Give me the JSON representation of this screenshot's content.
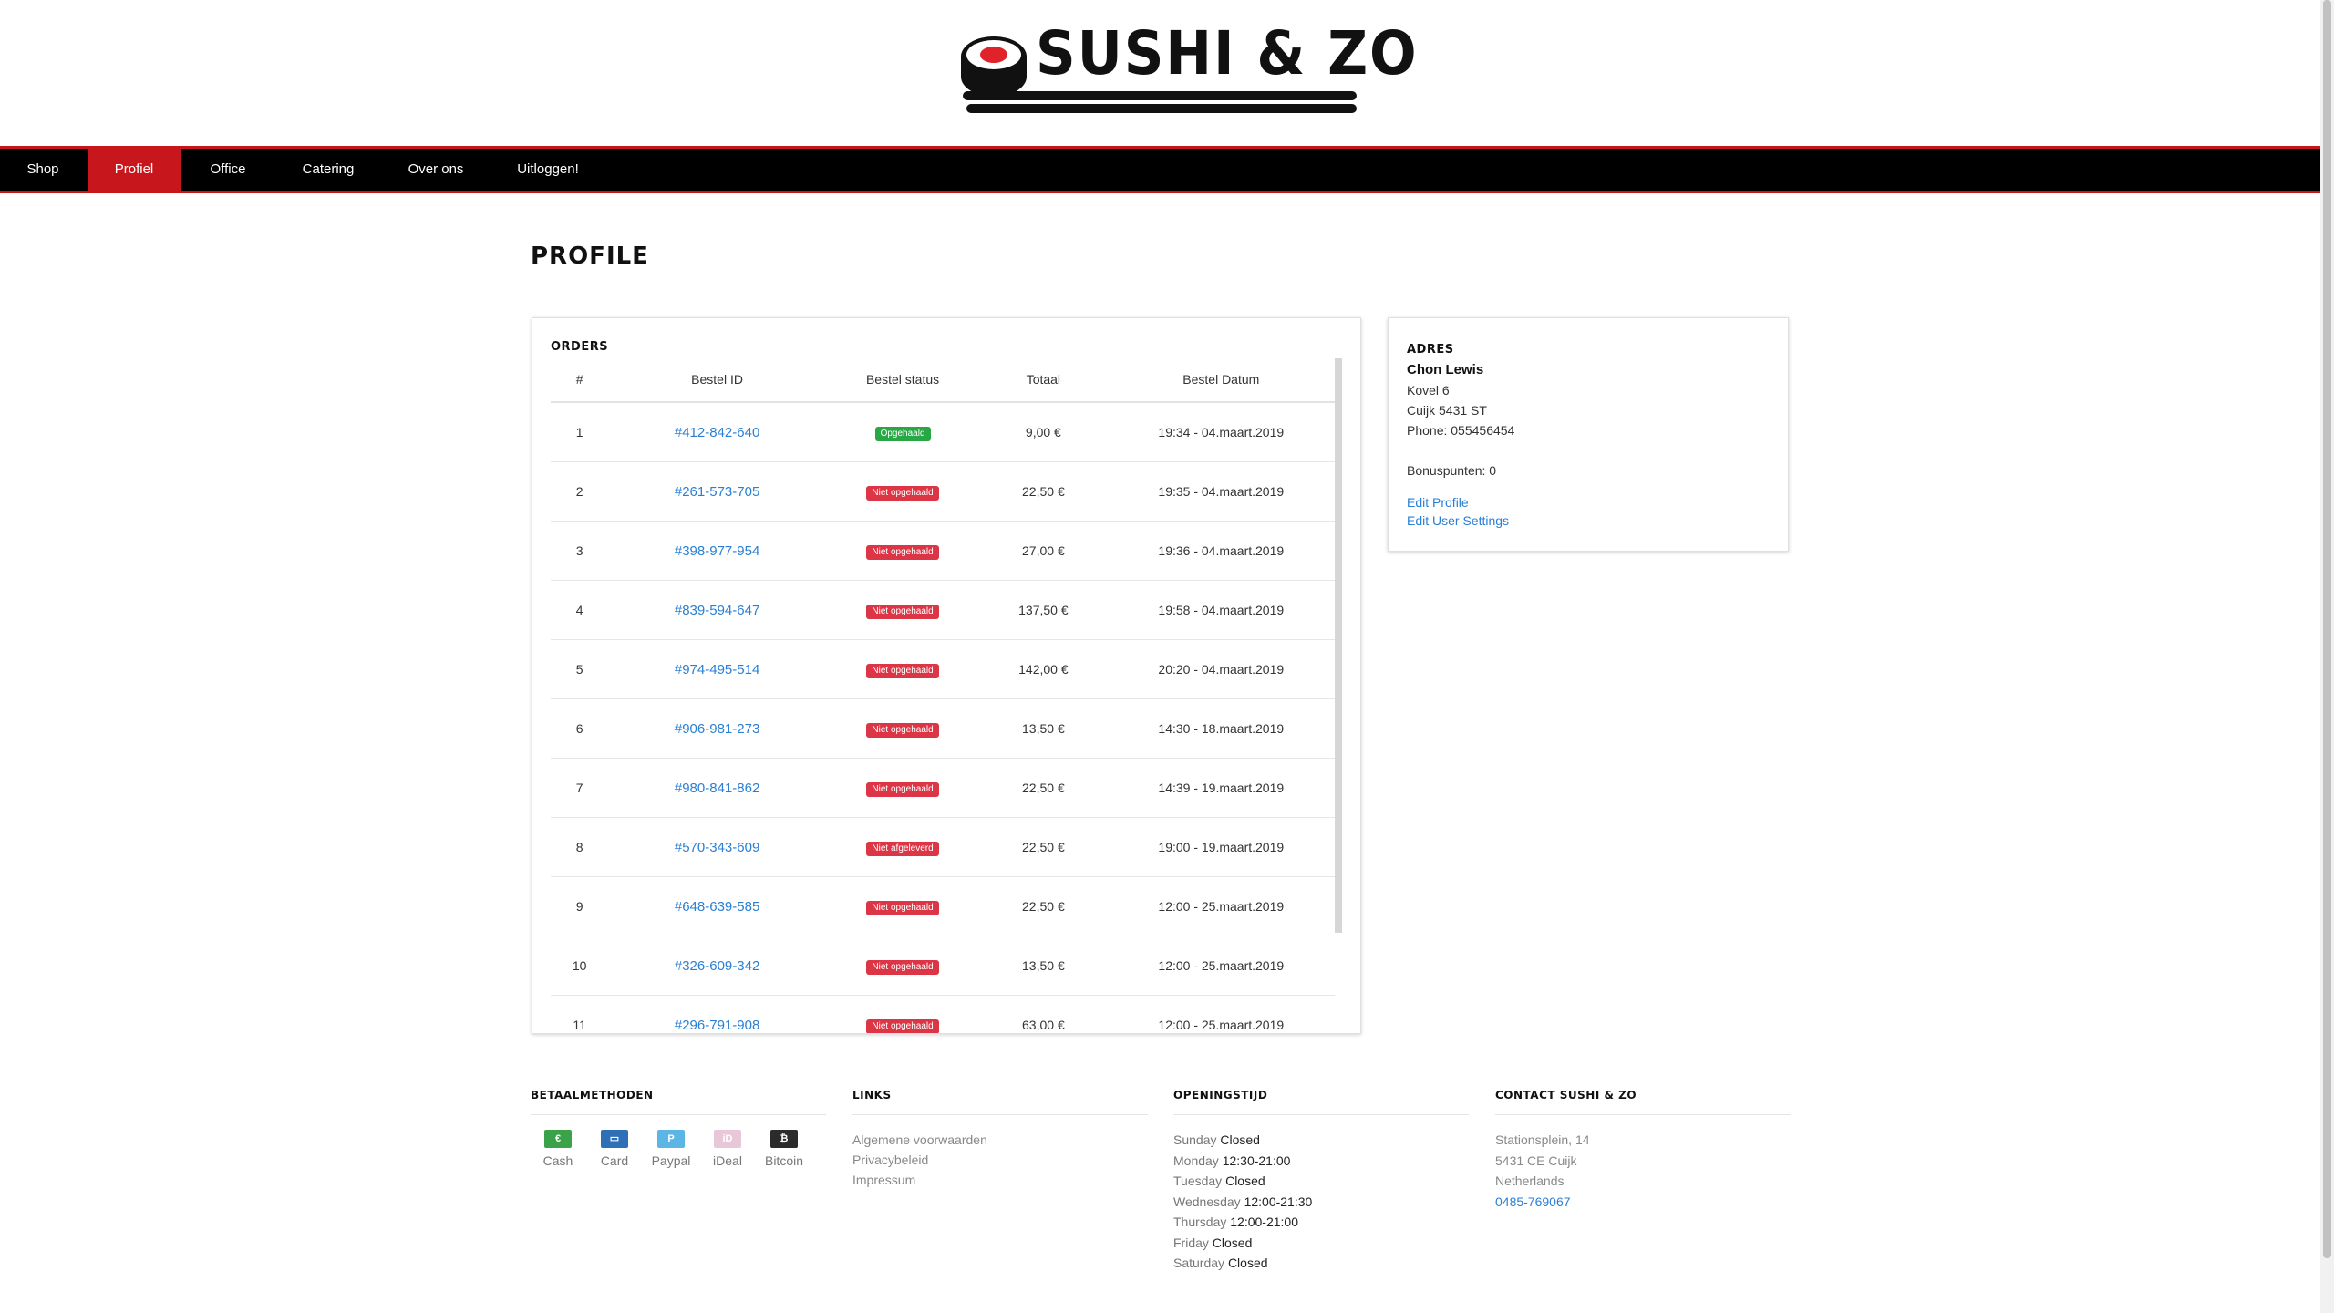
{
  "brand": {
    "name": "SUSHI & ZO",
    "accent": "#c8161d"
  },
  "nav": {
    "items": [
      {
        "label": "Shop",
        "active": false
      },
      {
        "label": "Profiel",
        "active": true
      },
      {
        "label": "Office",
        "active": false
      },
      {
        "label": "Catering",
        "active": false
      },
      {
        "label": "Over ons",
        "active": false
      },
      {
        "label": "Uitloggen!",
        "active": false
      }
    ]
  },
  "page": {
    "title": "Profile"
  },
  "orders": {
    "heading": "Orders",
    "columns": [
      "#",
      "Bestel ID",
      "Bestel status",
      "Totaal",
      "Bestel Datum"
    ],
    "rows": [
      {
        "num": "1",
        "id": "#412-842-640",
        "status": "Opgehaald",
        "status_color": "green",
        "total": "9,00 €",
        "date": "19:34 - 04.maart.2019"
      },
      {
        "num": "2",
        "id": "#261-573-705",
        "status": "Niet opgehaald",
        "status_color": "red",
        "total": "22,50 €",
        "date": "19:35 - 04.maart.2019"
      },
      {
        "num": "3",
        "id": "#398-977-954",
        "status": "Niet opgehaald",
        "status_color": "red",
        "total": "27,00 €",
        "date": "19:36 - 04.maart.2019"
      },
      {
        "num": "4",
        "id": "#839-594-647",
        "status": "Niet opgehaald",
        "status_color": "red",
        "total": "137,50 €",
        "date": "19:58 - 04.maart.2019"
      },
      {
        "num": "5",
        "id": "#974-495-514",
        "status": "Niet opgehaald",
        "status_color": "red",
        "total": "142,00 €",
        "date": "20:20 - 04.maart.2019"
      },
      {
        "num": "6",
        "id": "#906-981-273",
        "status": "Niet opgehaald",
        "status_color": "red",
        "total": "13,50 €",
        "date": "14:30 - 18.maart.2019"
      },
      {
        "num": "7",
        "id": "#980-841-862",
        "status": "Niet opgehaald",
        "status_color": "red",
        "total": "22,50 €",
        "date": "14:39 - 19.maart.2019"
      },
      {
        "num": "8",
        "id": "#570-343-609",
        "status": "Niet afgeleverd",
        "status_color": "red",
        "total": "22,50 €",
        "date": "19:00 - 19.maart.2019"
      },
      {
        "num": "9",
        "id": "#648-639-585",
        "status": "Niet opgehaald",
        "status_color": "red",
        "total": "22,50 €",
        "date": "12:00 - 25.maart.2019"
      },
      {
        "num": "10",
        "id": "#326-609-342",
        "status": "Niet opgehaald",
        "status_color": "red",
        "total": "13,50 €",
        "date": "12:00 - 25.maart.2019"
      },
      {
        "num": "11",
        "id": "#296-791-908",
        "status": "Niet opgehaald",
        "status_color": "red",
        "total": "63,00 €",
        "date": "12:00 - 25.maart.2019"
      }
    ]
  },
  "adres": {
    "heading": "Adres",
    "name": "Chon Lewis",
    "street": "Kovel 6",
    "city": "Cuijk 5431 ST",
    "phone": "Phone: 055456454",
    "bonus": "Bonuspunten: 0",
    "edit_profile": "Edit Profile",
    "edit_settings": "Edit User Settings"
  },
  "footer": {
    "payment": {
      "title": "Betaalmethoden",
      "methods": [
        {
          "label": "Cash",
          "icon": "cash-icon",
          "color": "#3aa34a"
        },
        {
          "label": "Card",
          "icon": "card-icon",
          "color": "#2f6fb8"
        },
        {
          "label": "Paypal",
          "icon": "paypal-icon",
          "color": "#5bb6e6"
        },
        {
          "label": "iDeal",
          "icon": "ideal-icon",
          "color": "#e8c8d8"
        },
        {
          "label": "Bitcoin",
          "icon": "bitcoin-icon",
          "color": "#2b2b2b"
        }
      ]
    },
    "links": {
      "title": "Links",
      "items": [
        "Algemene voorwaarden",
        "Privacybeleid",
        "Impressum"
      ]
    },
    "hours": {
      "title": "Openingstijd",
      "days": [
        {
          "day": "Sunday",
          "time": "Closed"
        },
        {
          "day": "Monday",
          "time": "12:30-21:00"
        },
        {
          "day": "Tuesday",
          "time": "Closed"
        },
        {
          "day": "Wednesday",
          "time": "12:00-21:30"
        },
        {
          "day": "Thursday",
          "time": "12:00-21:00"
        },
        {
          "day": "Friday",
          "time": "Closed"
        },
        {
          "day": "Saturday",
          "time": "Closed"
        }
      ]
    },
    "contact": {
      "title": "Contact Sushi & Zo",
      "street": "Stationsplein, 14",
      "city": "5431 CE Cuijk",
      "country": "Netherlands",
      "phone": "0485-769067"
    }
  }
}
